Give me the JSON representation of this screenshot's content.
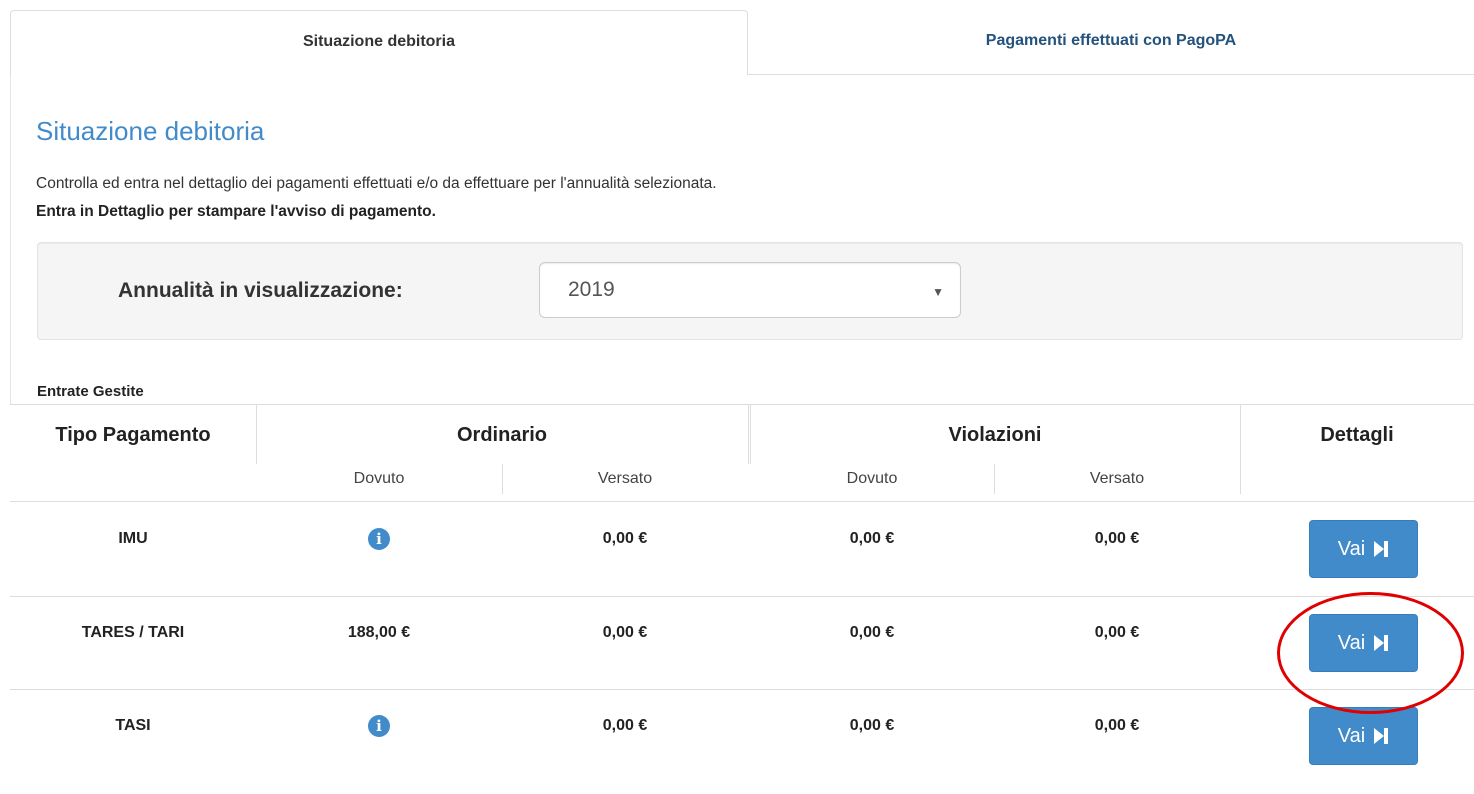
{
  "tabs": {
    "active_label": "Situazione debitoria",
    "inactive_label": "Pagamenti effettuati con PagoPA"
  },
  "header": {
    "title": "Situazione debitoria",
    "description": "Controlla ed entra nel dettaglio dei pagamenti effettuati e/o da effettuare per l'annualità selezionata.",
    "note": "Entra in Dettaglio per stampare l'avviso di pagamento."
  },
  "filter": {
    "label": "Annualità in visualizzazione:",
    "selected_year": "2019"
  },
  "table": {
    "section_label": "Entrate Gestite",
    "headers": {
      "tipo": "Tipo Pagamento",
      "ordinario": "Ordinario",
      "violazioni": "Violazioni",
      "dettagli": "Dettagli"
    },
    "subheaders": {
      "ord_dovuto": "Dovuto",
      "ord_versato": "Versato",
      "viol_dovuto": "Dovuto",
      "viol_versato": "Versato"
    },
    "rows": [
      {
        "tipo": "IMU",
        "ord_dovuto": "",
        "ord_dovuto_icon": "info-icon",
        "ord_versato": "0,00 €",
        "viol_dovuto": "0,00 €",
        "viol_versato": "0,00 €",
        "action": "Vai"
      },
      {
        "tipo": "TARES / TARI",
        "ord_dovuto": "188,00 €",
        "ord_versato": "0,00 €",
        "viol_dovuto": "0,00 €",
        "viol_versato": "0,00 €",
        "action": "Vai"
      },
      {
        "tipo": "TASI",
        "ord_dovuto": "",
        "ord_dovuto_icon": "info-icon",
        "ord_versato": "0,00 €",
        "viol_dovuto": "0,00 €",
        "viol_versato": "0,00 €",
        "action": "Vai"
      }
    ]
  },
  "info_icon_glyph": "i",
  "colors": {
    "accent": "#428bca",
    "tab_link": "#23527c",
    "highlight": "#e00000"
  }
}
